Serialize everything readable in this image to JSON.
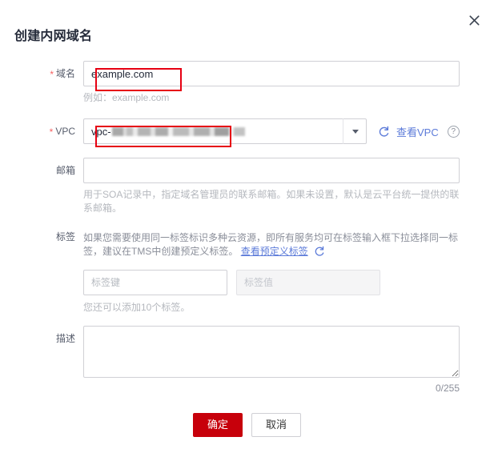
{
  "dialog": {
    "title": "创建内网域名",
    "close_icon": "close-icon"
  },
  "form": {
    "domain": {
      "label": "域名",
      "required_mark": "*",
      "value": "example.com",
      "placeholder": "",
      "hint": "例如：example.com"
    },
    "vpc": {
      "label": "VPC",
      "required_mark": "*",
      "value_prefix": "vpc-",
      "value_redacted": true,
      "refresh_icon": "refresh-icon",
      "view_link": "查看VPC",
      "help_icon": "help-circle-icon",
      "dropdown_icon": "chevron-down-icon"
    },
    "email": {
      "label": "邮箱",
      "value": "",
      "placeholder": "",
      "hint": "用于SOA记录中，指定域名管理员的联系邮箱。如果未设置，默认是云平台统一提供的联系邮箱。"
    },
    "tag": {
      "label": "标签",
      "description": "如果您需要使用同一标签标识多种云资源，即所有服务均可在标签输入框下拉选择同一标签，建议在TMS中创建预定义标签。",
      "predefined_link": "查看预定义标签",
      "refresh_icon": "refresh-icon",
      "key_placeholder": "标签键",
      "value_placeholder": "标签值",
      "key_value": "",
      "value_value": "",
      "remaining_hint": "您还可以添加10个标签。"
    },
    "description": {
      "label": "描述",
      "value": "",
      "placeholder": "",
      "counter": "0/255"
    }
  },
  "footer": {
    "confirm_label": "确定",
    "cancel_label": "取消"
  },
  "colors": {
    "primary": "#c7000b",
    "link": "#5c7bd9",
    "required": "#f76262",
    "annotation": "#e60012",
    "title": "#252b3a"
  }
}
